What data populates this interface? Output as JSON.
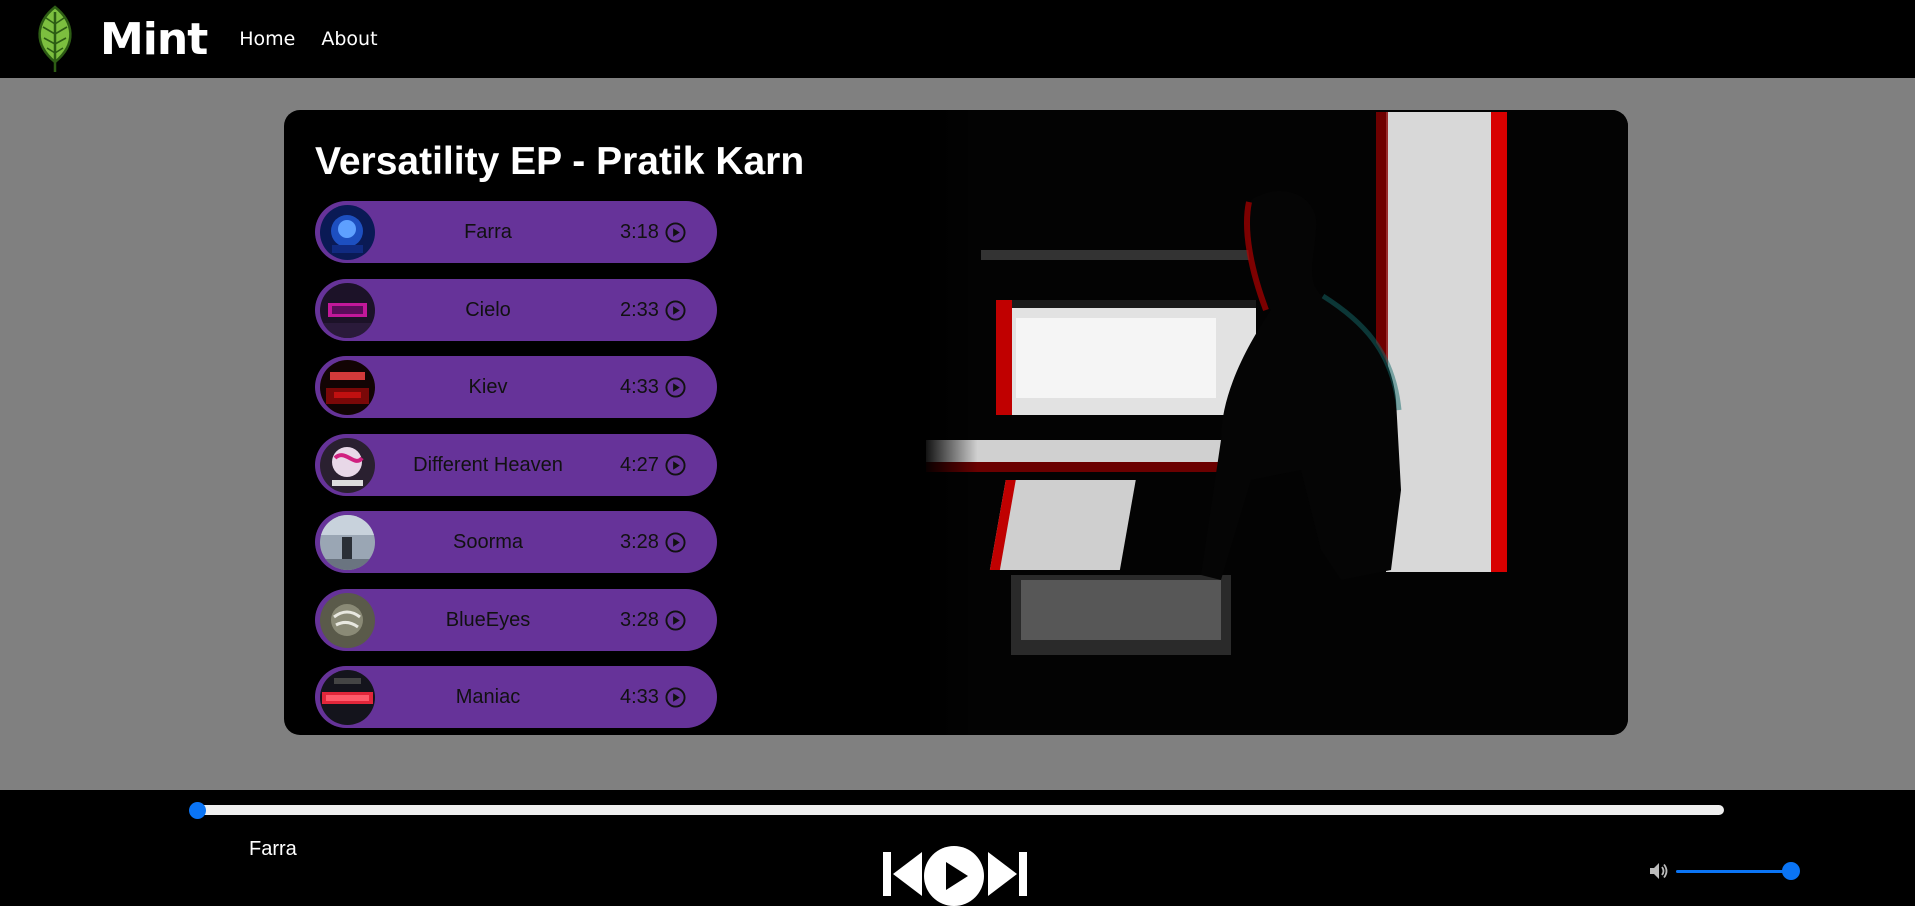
{
  "nav": {
    "brand": "Mint",
    "links": [
      "Home",
      "About"
    ]
  },
  "album": {
    "title": "Versatility EP - Pratik Karn",
    "tracks": [
      {
        "name": "Farra",
        "duration": "3:18"
      },
      {
        "name": "Cielo",
        "duration": "2:33"
      },
      {
        "name": "Kiev",
        "duration": "4:33"
      },
      {
        "name": "Different Heaven",
        "duration": "4:27"
      },
      {
        "name": "Soorma",
        "duration": "3:28"
      },
      {
        "name": "BlueEyes",
        "duration": "3:28"
      },
      {
        "name": "Maniac",
        "duration": "4:33"
      }
    ]
  },
  "player": {
    "now_playing": "Farra",
    "progress": 0,
    "volume": 1.0
  },
  "icons": {
    "logo": "leaf-icon",
    "track_action": "play-circle-icon",
    "controls": [
      "skip-back-icon",
      "play-icon",
      "skip-forward-icon"
    ],
    "volume": "volume-icon"
  },
  "colors": {
    "track_bg": "#663399",
    "accent": "#0a74f5",
    "nav_bg": "#000000",
    "page_bg": "#808080"
  }
}
